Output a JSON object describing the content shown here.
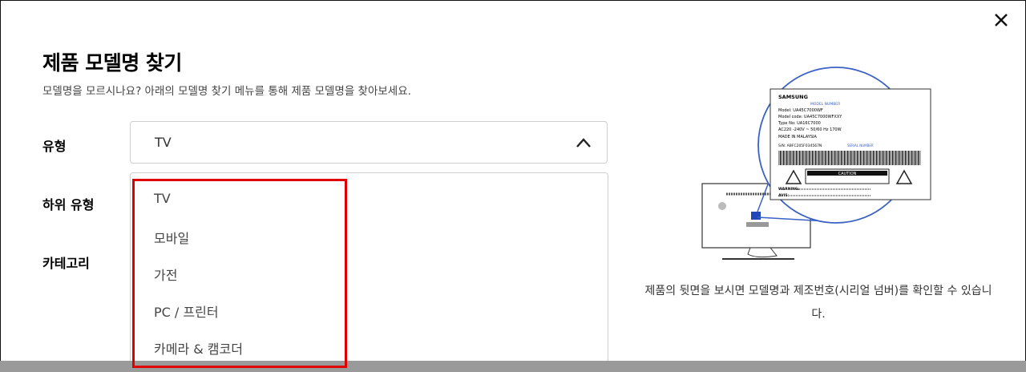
{
  "dialog": {
    "title": "제품 모델명 찾기",
    "subtitle": "모델명을 모르시나요? 아래의 모델명 찾기 메뉴를 통해 제품 모델명을 찾아보세요."
  },
  "form": {
    "type_label": "유형",
    "subtype_label": "하위 유형",
    "category_label": "카테고리",
    "selected_type": "TV"
  },
  "dropdown": {
    "options": [
      "TV",
      "모바일",
      "가전",
      "PC / 프린터",
      "카메라 & 캠코더"
    ]
  },
  "illustration": {
    "brand": "SAMSUNG",
    "model_number_tag": "MODEL NUMBER",
    "model": "Model: UA45C7000WF",
    "model_code": "Model code: UA45C7000WFXXY",
    "type_no": "Type No: UA16C7000",
    "power": "AC220 -240V ~ 50/60 Hz 170W",
    "made_in": "MADE IN MALAYSIA",
    "serial": "S/N: ABFC205F034567N",
    "serial_tag": "SERIAL NUMBER",
    "caution": "CAUTION",
    "warning": "WARNING:",
    "avis": "AVIS:",
    "caption": "제품의 뒷면을 보시면 모델명과 제조번호(시리얼 넘버)를 확인할 수 있습니다."
  },
  "colors": {
    "highlight": "#e00000",
    "illustration_blue": "#3a62c4"
  }
}
